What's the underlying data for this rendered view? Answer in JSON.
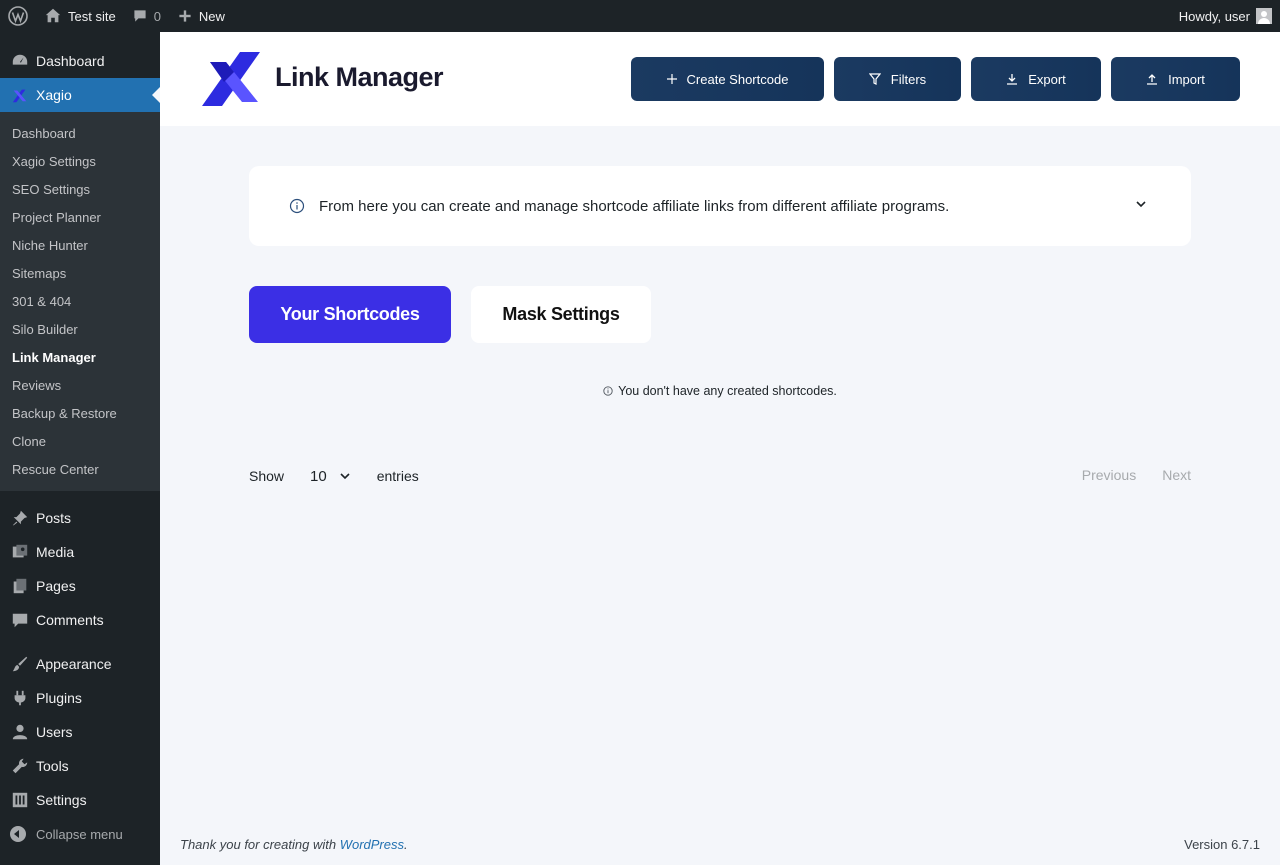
{
  "admin_bar": {
    "site_name": "Test site",
    "comments_count": "0",
    "new_label": "New",
    "greeting": "Howdy, user"
  },
  "sidebar": {
    "top_items": [
      {
        "label": "Dashboard",
        "icon": "dashboard-icon"
      },
      {
        "label": "Xagio",
        "icon": "xagio-icon"
      }
    ],
    "xagio_submenu": [
      "Dashboard",
      "Xagio Settings",
      "SEO Settings",
      "Project Planner",
      "Niche Hunter",
      "Sitemaps",
      "301 & 404",
      "Silo Builder",
      "Link Manager",
      "Reviews",
      "Backup & Restore",
      "Clone",
      "Rescue Center"
    ],
    "active_sub": "Link Manager",
    "items_group1": [
      {
        "label": "Posts",
        "icon": "pin-icon"
      },
      {
        "label": "Media",
        "icon": "media-icon"
      },
      {
        "label": "Pages",
        "icon": "pages-icon"
      },
      {
        "label": "Comments",
        "icon": "comment-icon"
      }
    ],
    "items_group2": [
      {
        "label": "Appearance",
        "icon": "brush-icon"
      },
      {
        "label": "Plugins",
        "icon": "plug-icon"
      },
      {
        "label": "Users",
        "icon": "user-icon"
      },
      {
        "label": "Tools",
        "icon": "wrench-icon"
      },
      {
        "label": "Settings",
        "icon": "settings-icon"
      }
    ],
    "collapse_label": "Collapse menu"
  },
  "header": {
    "title": "Link Manager",
    "buttons": {
      "create": "Create Shortcode",
      "filters": "Filters",
      "export": "Export",
      "import": "Import"
    }
  },
  "notice": {
    "text": "From here you can create and manage shortcode affiliate links from different affiliate programs."
  },
  "tabs": {
    "shortcodes": "Your Shortcodes",
    "mask": "Mask Settings"
  },
  "table": {
    "empty_message": "You don't have any created shortcodes.",
    "show_label": "Show",
    "entries_value": "10",
    "entries_label": "entries",
    "previous": "Previous",
    "next": "Next"
  },
  "footer": {
    "thanks_prefix": "Thank you for creating with ",
    "wp_link": "WordPress",
    "thanks_suffix": ".",
    "version": "Version 6.7.1"
  },
  "colors": {
    "admin_dark": "#1d2327",
    "wp_blue": "#2271b1",
    "accent_purple": "#3b2fe5",
    "header_button": "#1b3a61"
  }
}
